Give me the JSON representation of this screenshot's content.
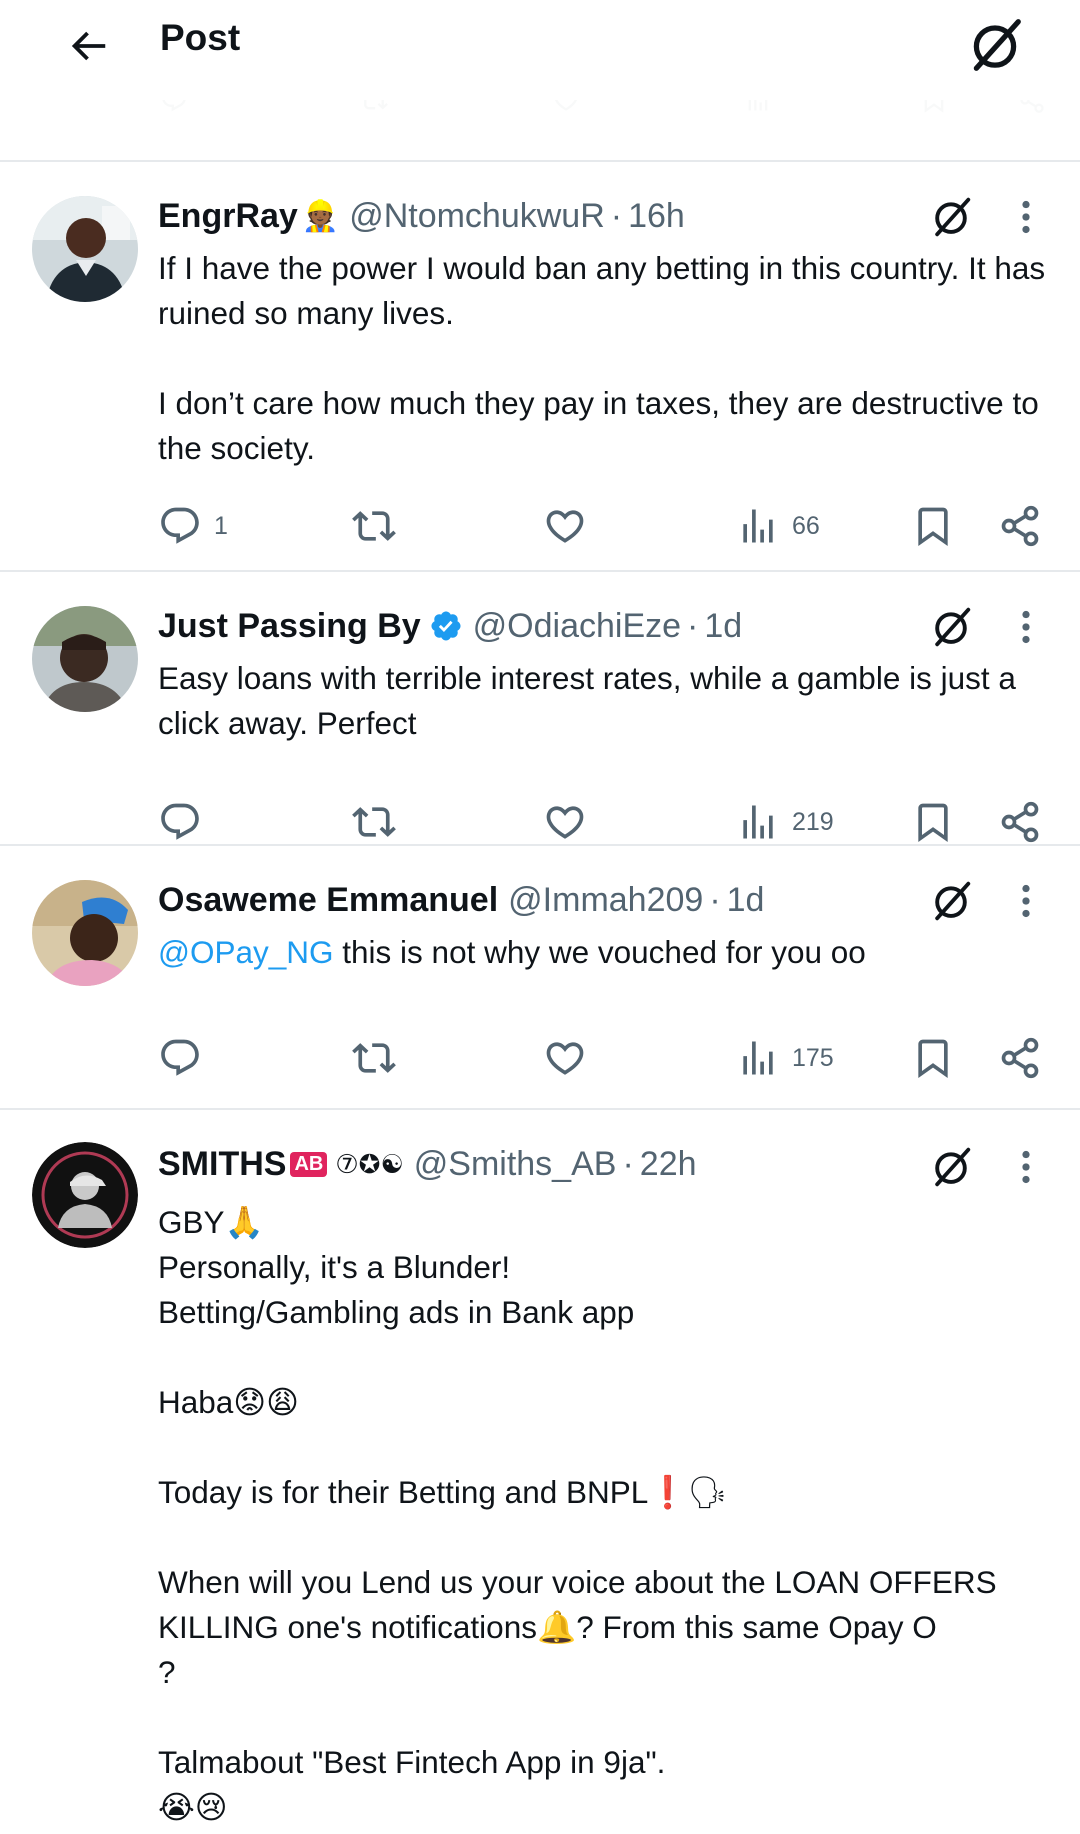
{
  "header": {
    "title": "Post"
  },
  "replies": [
    {
      "name": "EngrRay",
      "handle": "@NtomchukwuR",
      "time": "16h",
      "text": "If I have the power I would ban any betting in this country. It has ruined so many lives.\n\nI don’t care how much they pay in taxes, they are destructive to the society.",
      "reply_count": "1",
      "views": "66"
    },
    {
      "name": "Just Passing By",
      "handle": "@OdiachiEze",
      "time": "1d",
      "text": "Easy loans with terrible interest rates, while a gamble is just a click away. Perfect",
      "reply_count": "",
      "views": "219"
    },
    {
      "name": "Osaweme Emmanuel",
      "handle": "@Immah209",
      "time": "1d",
      "mention": "@OPay_NG",
      "text": " this is not why we vouched for you oo",
      "reply_count": "",
      "views": "175"
    },
    {
      "name": "SMITHS",
      "name_badge": "AB",
      "handle": "@Smiths_AB",
      "time": "22h",
      "lines": [
        "GBY🙏",
        "Personally, it's a Blunder!",
        "Betting/Gambling ads in Bank app",
        "",
        "Haba😟😩",
        "",
        "Today is for their Betting and BNPL❗🗣",
        "",
        "When will you Lend us your voice about the LOAN OFFERS KILLING one's notifications🔔? From this same Opay O",
        "?",
        "",
        "Talmabout \"Best Fintech App in 9ja\".",
        "😭😢"
      ]
    }
  ],
  "icons": [
    "back-arrow-icon",
    "grok-icon",
    "reply-icon",
    "repost-icon",
    "like-icon",
    "views-icon",
    "bookmark-icon",
    "share-icon",
    "more-icon",
    "verified-badge-icon"
  ],
  "colors": {
    "link": "#1d9bf0",
    "secondary_text": "#536471",
    "verified": "#1d9bf0",
    "badge_red": "#e0245e"
  }
}
